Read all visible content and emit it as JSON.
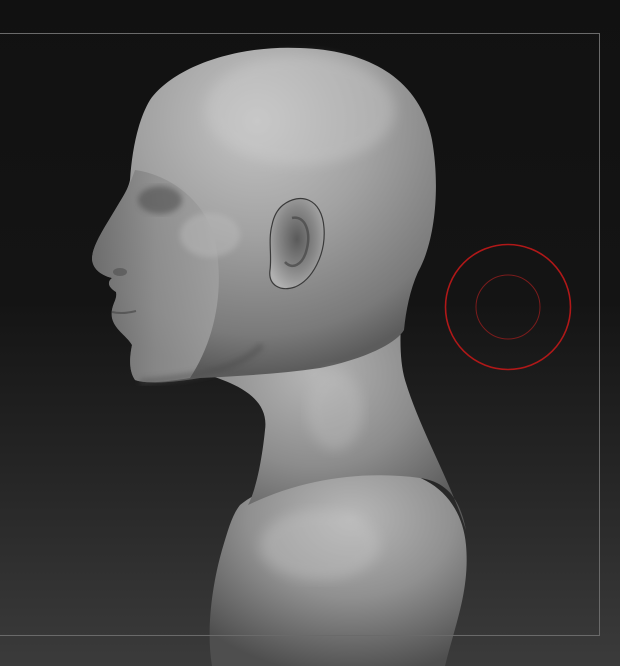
{
  "viewport": {
    "background_top": "#111111",
    "background_bottom": "#3b3b3b",
    "frame_color": "#6a6a6a"
  },
  "model": {
    "kind": "sculpted-head-bust",
    "view": "left-profile",
    "material": "matcap-gray",
    "base_color": "#8f8f8f",
    "highlight_color": "#c9c9c9",
    "shadow_color": "#3e3e3e"
  },
  "brush_cursor": {
    "outer_ring_color": "#b01818",
    "inner_ring_color": "#7a1c1c"
  }
}
